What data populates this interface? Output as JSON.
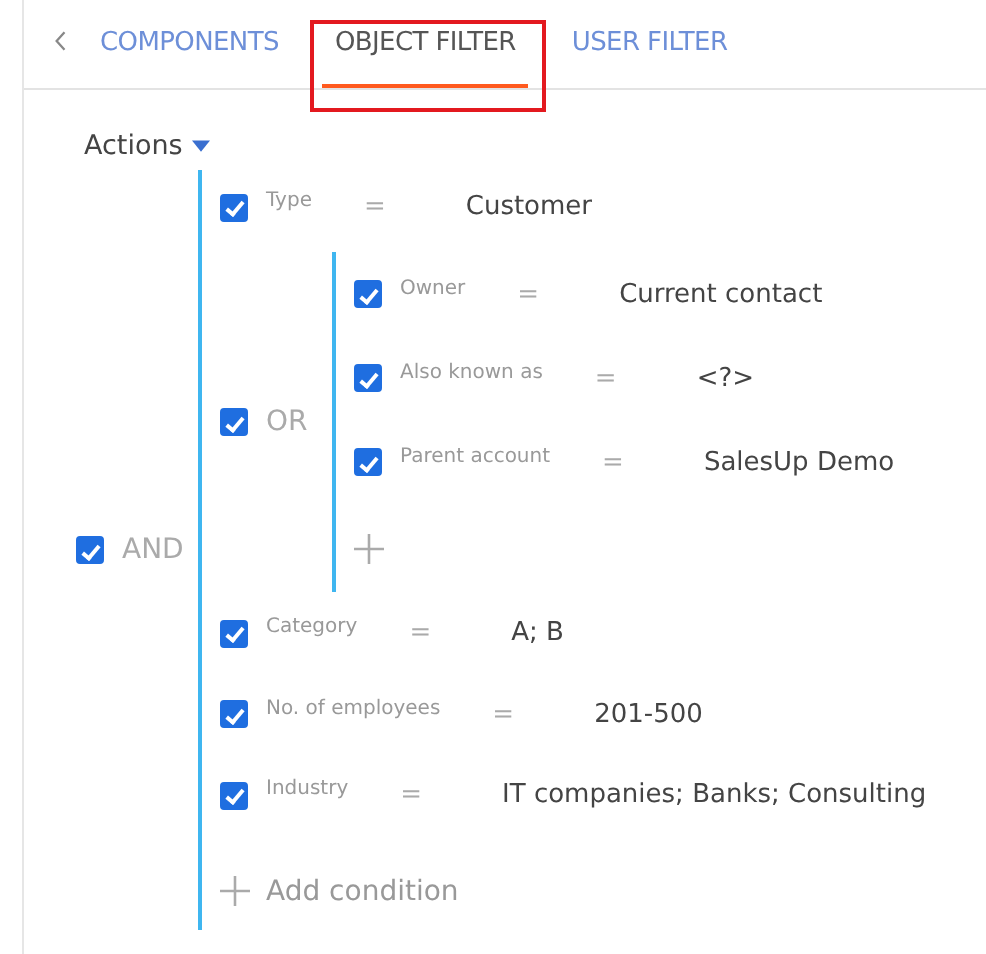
{
  "tabs": [
    {
      "label": "COMPONENTS",
      "selected": false,
      "highlighted": false
    },
    {
      "label": "OBJECT FILTER",
      "selected": true,
      "highlighted": true
    },
    {
      "label": "USER FILTER",
      "selected": false,
      "highlighted": false
    }
  ],
  "actions_menu": {
    "label": "Actions"
  },
  "filter": {
    "kind": "group",
    "logic": "AND",
    "checked": true,
    "add_label": "Add condition",
    "items": [
      {
        "kind": "condition",
        "checked": true,
        "field": "Type",
        "operator": "=",
        "value": "Customer"
      },
      {
        "kind": "group",
        "logic": "OR",
        "checked": true,
        "items": [
          {
            "kind": "condition",
            "checked": true,
            "field": "Owner",
            "operator": "=",
            "value": "Current contact"
          },
          {
            "kind": "condition",
            "checked": true,
            "field": "Also known as",
            "operator": "=",
            "value": "<?>"
          },
          {
            "kind": "condition",
            "checked": true,
            "field": "Parent account",
            "operator": "=",
            "value": "SalesUp Demo"
          }
        ]
      },
      {
        "kind": "condition",
        "checked": true,
        "field": "Category",
        "operator": "=",
        "value": "A; B"
      },
      {
        "kind": "condition",
        "checked": true,
        "field": "No. of employees",
        "operator": "=",
        "value": "201-500"
      },
      {
        "kind": "condition",
        "checked": true,
        "field": "Industry",
        "operator": "=",
        "value": "IT companies; Banks; Consulting"
      }
    ]
  }
}
